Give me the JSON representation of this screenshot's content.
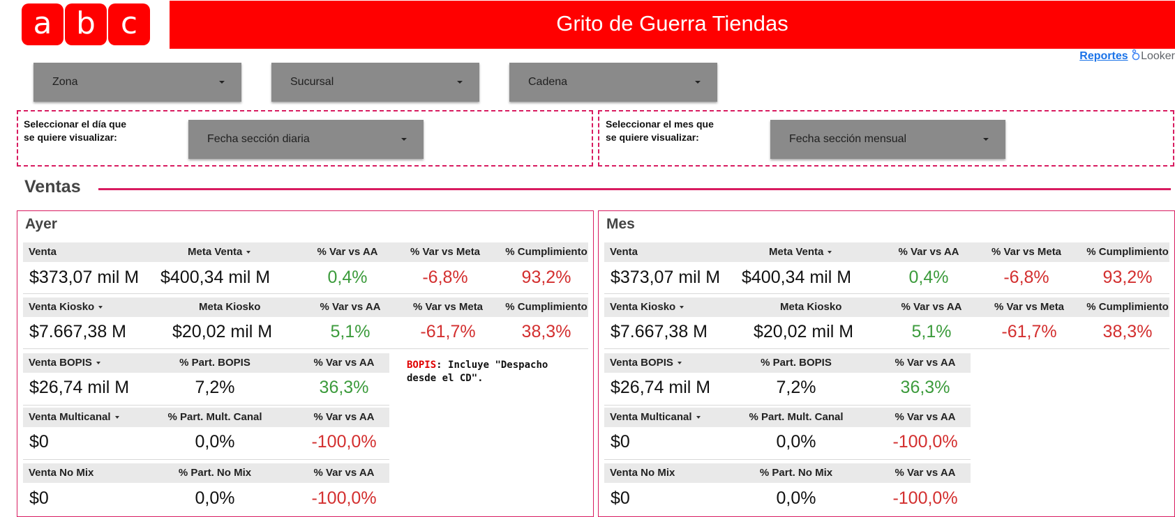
{
  "logo": {
    "letters": [
      "a",
      "b",
      "c"
    ]
  },
  "header": {
    "title": "Grito de Guerra Tiendas"
  },
  "looker": {
    "reports": "Reportes",
    "brand": "Looker"
  },
  "filters": {
    "zona": "Zona",
    "sucursal": "Sucursal",
    "cadena": "Cadena"
  },
  "date_filters": {
    "daily_label_1": "Seleccionar el día que",
    "daily_label_2": "se quiere visualizar:",
    "daily": "Fecha sección diaria",
    "monthly_label_1": "Seleccionar el mes que",
    "monthly_label_2": "se quiere visualizar:",
    "monthly": "Fecha sección mensual"
  },
  "section": {
    "title": "Ventas"
  },
  "panels": [
    {
      "title": "Ayer",
      "row1": {
        "h": [
          "Venta",
          "Meta Venta",
          "% Var vs AA",
          "% Var vs Meta",
          "% Cumplimiento"
        ],
        "v": [
          "$373,07 mil M",
          "$400,34 mil M",
          "0,4%",
          "-6,8%",
          "93,2%"
        ]
      },
      "row2": {
        "h": [
          "Venta Kiosko",
          "Meta Kiosko",
          "% Var vs AA",
          "% Var vs Meta",
          "% Cumplimiento"
        ],
        "v": [
          "$7.667,38 M",
          "$20,02 mil M",
          "5,1%",
          "-61,7%",
          "38,3%"
        ]
      },
      "row3": {
        "h": [
          "Venta BOPIS",
          "% Part. BOPIS",
          "% Var vs AA"
        ],
        "v": [
          "$26,74 mil M",
          "7,2%",
          "36,3%"
        ]
      },
      "row4": {
        "h": [
          "Venta Multicanal",
          "% Part. Mult. Canal",
          "% Var vs AA"
        ],
        "v": [
          "$0",
          "0,0%",
          "-100,0%"
        ]
      },
      "row5": {
        "h": [
          "Venta No Mix",
          "% Part. No Mix",
          "% Var vs AA"
        ],
        "v": [
          "$0",
          "0,0%",
          "-100,0%"
        ]
      },
      "note": {
        "label": "BOPIS",
        "text_1": ": Incluye \"Despacho",
        "text_2": "desde el CD\"."
      }
    },
    {
      "title": "Mes",
      "row1": {
        "h": [
          "Venta",
          "Meta Venta",
          "% Var vs AA",
          "% Var vs Meta",
          "% Cumplimiento"
        ],
        "v": [
          "$373,07 mil M",
          "$400,34 mil M",
          "0,4%",
          "-6,8%",
          "93,2%"
        ]
      },
      "row2": {
        "h": [
          "Venta Kiosko",
          "Meta Kiosko",
          "% Var vs AA",
          "% Var vs Meta",
          "% Cumplimiento"
        ],
        "v": [
          "$7.667,38 M",
          "$20,02 mil M",
          "5,1%",
          "-61,7%",
          "38,3%"
        ]
      },
      "row3": {
        "h": [
          "Venta BOPIS",
          "% Part. BOPIS",
          "% Var vs AA"
        ],
        "v": [
          "$26,74 mil M",
          "7,2%",
          "36,3%"
        ]
      },
      "row4": {
        "h": [
          "Venta Multicanal",
          "% Part. Mult. Canal",
          "% Var vs AA"
        ],
        "v": [
          "$0",
          "0,0%",
          "-100,0%"
        ]
      },
      "row5": {
        "h": [
          "Venta No Mix",
          "% Part. No Mix",
          "% Var vs AA"
        ],
        "v": [
          "$0",
          "0,0%",
          "-100,0%"
        ]
      }
    }
  ]
}
